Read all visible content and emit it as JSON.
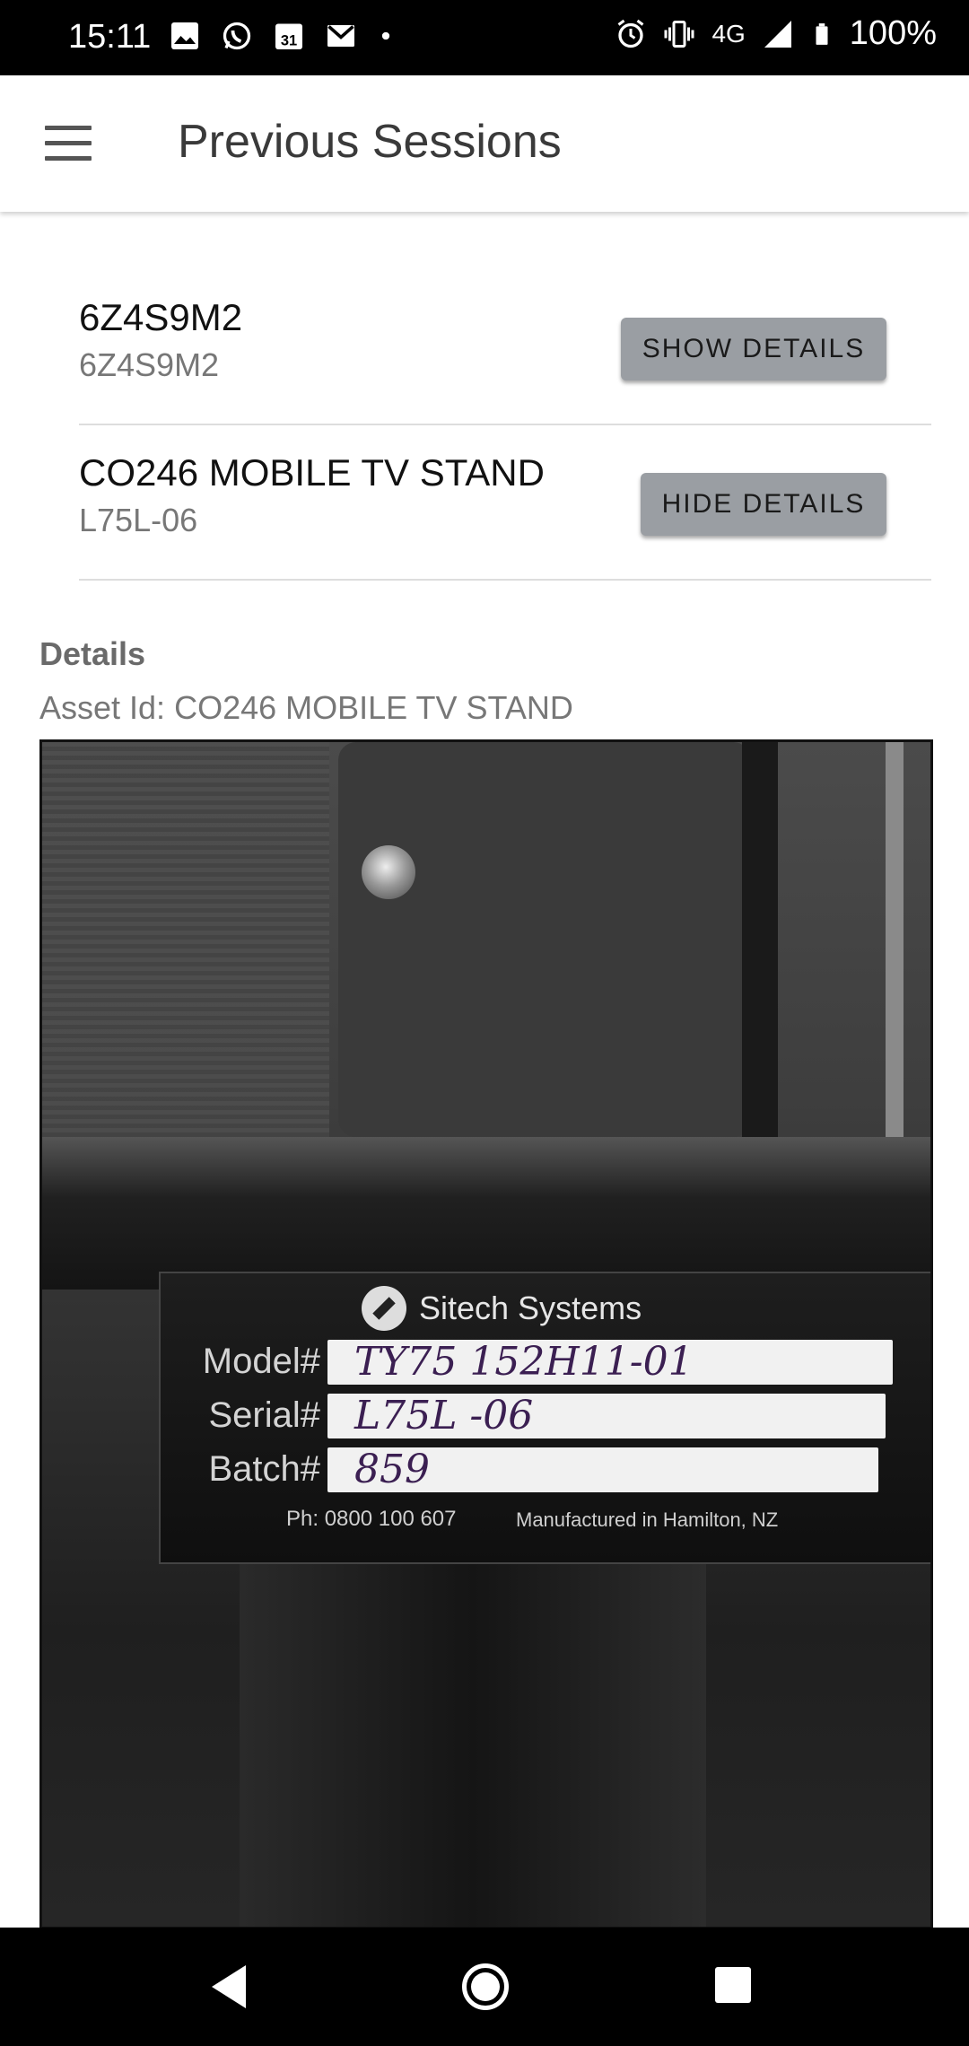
{
  "status_bar": {
    "time": "15:11",
    "network": "4G",
    "battery": "100%",
    "left_icons": [
      "image-icon",
      "whatsapp-icon",
      "calendar-icon",
      "gmail-icon",
      "dot-icon"
    ],
    "calendar_day": "31",
    "right_icons": [
      "alarm-icon",
      "vibrate-icon",
      "signal-icon",
      "battery-icon"
    ]
  },
  "appbar": {
    "title": "Previous Sessions",
    "menu_icon": "hamburger-menu-icon"
  },
  "sessions": [
    {
      "title": "6Z4S9M2",
      "subtitle": "6Z4S9M2",
      "button_label": "SHOW DETAILS"
    },
    {
      "title": "CO246 MOBILE TV STAND",
      "subtitle": "L75L-06",
      "button_label": "HIDE DETAILS"
    }
  ],
  "details": {
    "heading": "Details",
    "asset_line": "Asset Id: CO246 MOBILE TV STAND"
  },
  "photo": {
    "brand": "Sitech Systems",
    "fields": [
      {
        "label": "Model#",
        "value": "TY75   152H11-01"
      },
      {
        "label": "Serial#",
        "value": "L75L  -06"
      },
      {
        "label": "Batch#",
        "value": "859"
      }
    ],
    "phone": "Ph: 0800 100 607",
    "manufactured": "Manufactured in Hamilton, NZ"
  },
  "navbar": {
    "icons": [
      "back-icon",
      "home-icon",
      "recents-icon"
    ]
  }
}
